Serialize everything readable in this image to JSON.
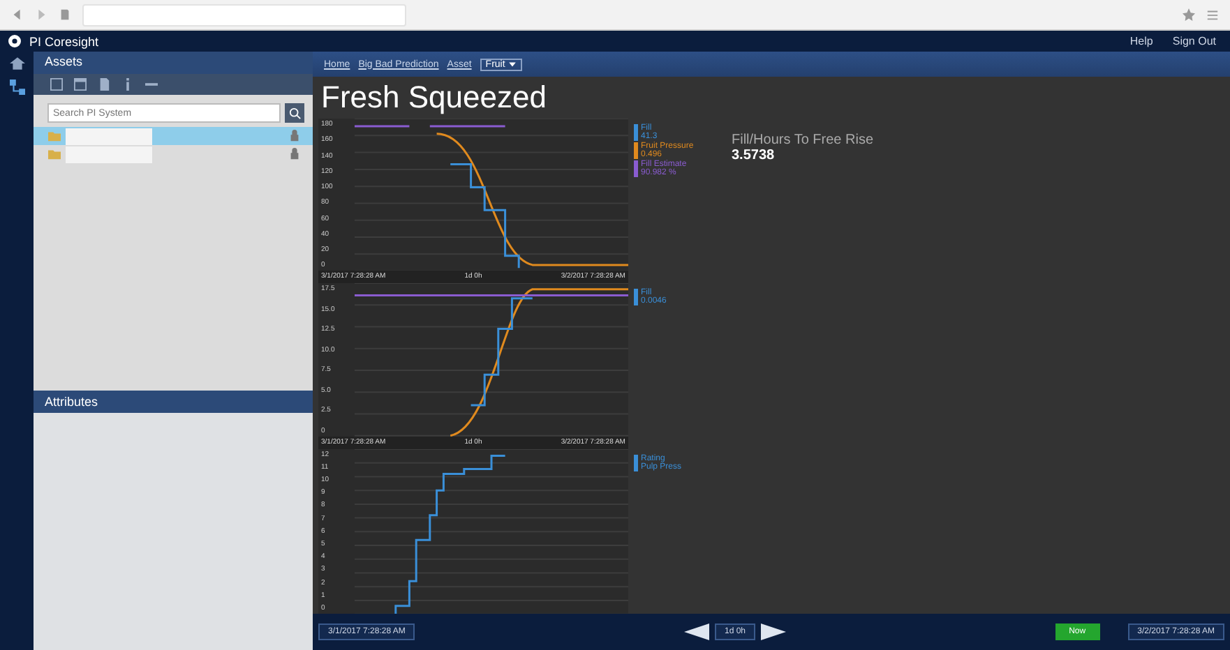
{
  "app": {
    "title": "PI Coresight",
    "header_links": [
      "Help",
      "Sign Out"
    ]
  },
  "assets_panel": {
    "title": "Assets",
    "search": {
      "placeholder": "Search PI System"
    },
    "items": [
      {
        "selected": true
      },
      {
        "selected": false
      }
    ]
  },
  "attributes_panel": {
    "title": "Attributes"
  },
  "breadcrumb": [
    "Home",
    "Big Bad Prediction",
    "Asset"
  ],
  "asset_picker": {
    "value": "Fruit"
  },
  "display": {
    "title": "Fresh Squeezed",
    "value_label": "Fill/Hours To Free Rise",
    "value": "3.5738"
  },
  "trends": [
    {
      "kind": "falling",
      "y_ticks": [
        "180",
        "160",
        "140",
        "120",
        "100",
        "80",
        "60",
        "40",
        "20",
        "0"
      ],
      "x_labels": [
        "3/1/2017 7:28:28 AM",
        "1d 0h",
        "3/2/2017 7:28:28 AM"
      ],
      "legend": [
        {
          "name": "Fill",
          "value": "41.3",
          "color": "#3a8fd8"
        },
        {
          "name": "Fruit Pressure",
          "value": "0.496",
          "color": "#e08a1e"
        },
        {
          "name": "Fill Estimate",
          "value": "90.982 %",
          "color": "#8a5cd0"
        }
      ]
    },
    {
      "kind": "rising",
      "y_ticks": [
        "17.5",
        "15.0",
        "12.5",
        "10.0",
        "7.5",
        "5.0",
        "2.5",
        "0"
      ],
      "x_labels": [
        "3/1/2017 7:28:28 AM",
        "1d 0h",
        "3/2/2017 7:28:28 AM"
      ],
      "legend": [
        {
          "name": "Fill",
          "value": "0.0046",
          "color": "#3a8fd8"
        }
      ]
    },
    {
      "kind": "steps",
      "y_ticks": [
        "12",
        "11",
        "10",
        "9",
        "8",
        "7",
        "6",
        "5",
        "4",
        "3",
        "2",
        "1",
        "0"
      ],
      "legend": [
        {
          "name": "Rating",
          "value": "Pulp Press",
          "color": "#3a8fd8"
        }
      ]
    }
  ],
  "time_bar": {
    "start": "3/1/2017 7:28:28 AM",
    "duration": "1d 0h",
    "now": "Now",
    "end": "3/2/2017 7:28:28 AM"
  }
}
